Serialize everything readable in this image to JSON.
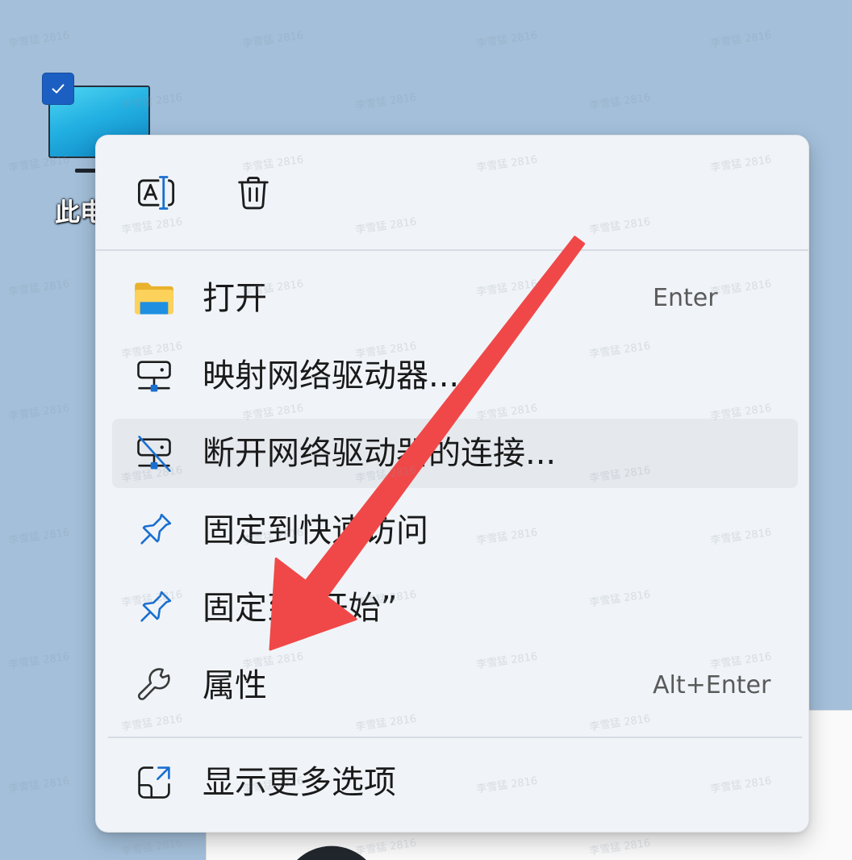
{
  "desktop": {
    "icon_label": "此电",
    "icon_name": "this-pc-icon",
    "selected": true
  },
  "watermark": "李雪猛 2816",
  "context_menu": {
    "toolbar": [
      {
        "name": "rename",
        "icon": "rename-icon"
      },
      {
        "name": "delete",
        "icon": "trash-icon"
      }
    ],
    "items": [
      {
        "label": "打开",
        "shortcut": "Enter",
        "icon": "folder-icon"
      },
      {
        "label": "映射网络驱动器...",
        "icon": "map-network-drive-icon"
      },
      {
        "label": "断开网络驱动器的连接...",
        "icon": "disconnect-network-drive-icon",
        "hovered": true
      },
      {
        "label": "固定到快速访问",
        "icon": "pin-icon"
      },
      {
        "label": "固定到“开始”",
        "icon": "pin-icon"
      },
      {
        "label": "属性",
        "shortcut": "Alt+Enter",
        "icon": "wrench-icon"
      }
    ],
    "footer_item": {
      "label": "显示更多选项",
      "icon": "show-more-options-icon"
    }
  },
  "colors": {
    "desktop_background": "#a3bfda",
    "menu_background": "#f0f4f8",
    "hover_background": "#e5e9ee",
    "accent": "#1a6fd0",
    "annotation_arrow": "#f04848"
  }
}
